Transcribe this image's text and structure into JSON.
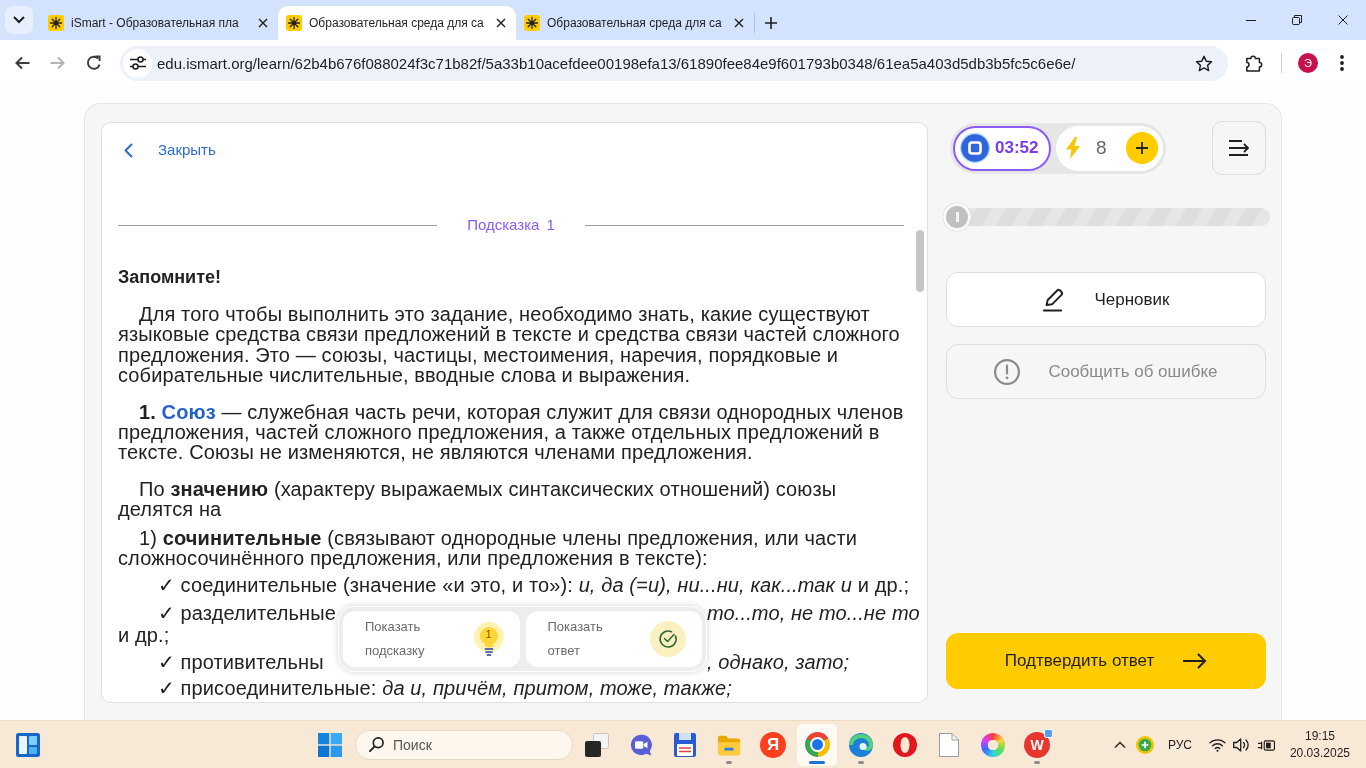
{
  "browser": {
    "tabs": [
      {
        "title": "iSmart - Образовательная пла",
        "selected": false
      },
      {
        "title": "Образовательная среда для са",
        "selected": true
      },
      {
        "title": "Образовательная среда для са",
        "selected": false
      }
    ],
    "nav": [
      {
        "kind": "back",
        "disabled": false
      },
      {
        "kind": "forward",
        "disabled": true
      },
      {
        "kind": "reload",
        "disabled": false
      }
    ],
    "url": "edu.ismart.org/learn/62b4b676f088024f3c71b82f/5a33b10acefdee00198efa13/61890fee84e9f601793b0348/61ea5a403d5db3b5fc5c6e6e/",
    "profile": "Э"
  },
  "hint": {
    "close": "Закрыть",
    "title": "Подсказка 1",
    "heading": "Запомните!",
    "blocks": [
      {
        "kind": "paragraph",
        "parts": [
          {
            "kind": "text",
            "text": "Для того чтобы выполнить это задание, необходимо знать, какие существуют языковые средства связи предложений в тексте и средства связи частей сложного предложения. Это — союзы, частицы, местоимения, наречия, порядковые и собирательные числительные, вводные слова и выражения."
          }
        ]
      },
      {
        "kind": "paragraph",
        "parts": [
          {
            "kind": "text",
            "text": "**1.** "
          },
          {
            "kind": "link",
            "text": "Союз"
          },
          {
            "kind": "text",
            "text": " — служебная часть речи, которая служит для связи однородных членов предложения, частей сложного предложения, а также отдельных предложений в тексте. Союзы не изменяются, не являются членами предложения."
          }
        ]
      },
      {
        "kind": "paragraph",
        "parts": [
          {
            "kind": "text",
            "text": "По **значению** (характеру выражаемых синтаксических отношений) союзы делятся на"
          }
        ]
      },
      {
        "kind": "point",
        "parts": [
          {
            "kind": "text",
            "text": "1) **сочинительные** (связывают однородные члены предложения, или части сложносочинённого предложения, или предложения в тексте):"
          }
        ]
      },
      {
        "kind": "bullet",
        "parts": [
          {
            "kind": "text",
            "text": "✓ соединительные (значение «и это, и то»): *и, да (=и), ни...ни, как...так и* и др.;"
          }
        ]
      },
      {
        "kind": "split",
        "left": "✓ разделительные",
        "right": "то...то, не то...не то"
      },
      {
        "kind": "line",
        "text": "и др.;"
      },
      {
        "kind": "split",
        "left": "✓ противительны",
        "right": ", однако, зато;"
      },
      {
        "kind": "bullet",
        "parts": [
          {
            "kind": "text",
            "text": "✓ присоединительные: *да и, причём, притом, тоже, также;*"
          }
        ]
      }
    ],
    "actions": [
      {
        "kind": "hint",
        "label": "Показать подсказку",
        "count": "1"
      },
      {
        "kind": "answer",
        "label": "Показать ответ"
      }
    ]
  },
  "sidebar": {
    "timer": "03:52",
    "energy": "8",
    "progress": {
      "level": 0
    },
    "tools": [
      {
        "kind": "draft",
        "label": "Черновик",
        "disabled": false
      },
      {
        "kind": "report",
        "label": "Сообщить об ошибке",
        "disabled": true
      }
    ],
    "submit": "Подтвердить ответ"
  },
  "taskbar": {
    "search": {
      "placeholder": "Поиск"
    },
    "apps": [
      {
        "kind": "taskview",
        "running": false,
        "selected": false
      },
      {
        "kind": "camera",
        "running": false,
        "selected": false
      },
      {
        "kind": "floppy",
        "running": false,
        "selected": false
      },
      {
        "kind": "folder",
        "running": true,
        "selected": false
      },
      {
        "kind": "letter",
        "label": "Я",
        "running": false,
        "selected": false
      },
      {
        "kind": "tricolor",
        "running": true,
        "selected": true
      },
      {
        "kind": "swirl",
        "running": true,
        "selected": false
      },
      {
        "kind": "ring",
        "running": false,
        "selected": false
      },
      {
        "kind": "document",
        "running": false,
        "selected": false
      },
      {
        "kind": "spectrum",
        "running": false,
        "selected": false
      },
      {
        "kind": "badged",
        "label": "W",
        "running": true,
        "selected": false
      }
    ],
    "tray": {
      "language": "РУС",
      "time": "19:15",
      "date": "20.03.2025"
    }
  }
}
